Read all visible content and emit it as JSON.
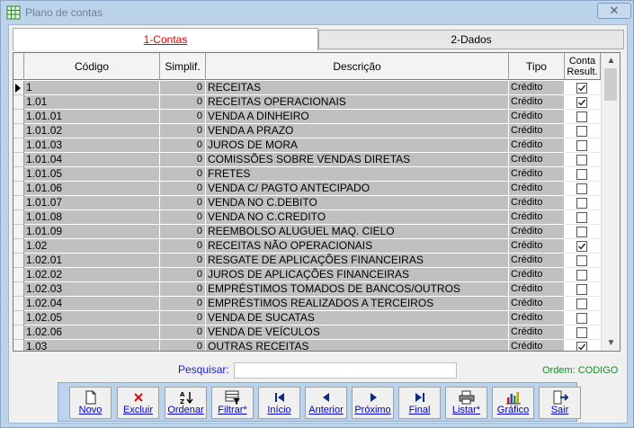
{
  "window": {
    "title": "Plano de contas",
    "close_glyph": "✕"
  },
  "tabs": [
    {
      "label": "1-Contas"
    },
    {
      "label": "2-Dados"
    }
  ],
  "grid": {
    "headers": {
      "codigo": "Código",
      "simplif": "Simplif.",
      "descricao": "Descrição",
      "tipo": "Tipo",
      "conta_result_line1": "Conta",
      "conta_result_line2": "Result."
    },
    "rows": [
      {
        "codigo": "1",
        "simplif": "0",
        "descricao": "RECEITAS",
        "tipo": "Crédito",
        "result": true
      },
      {
        "codigo": "1.01",
        "simplif": "0",
        "descricao": "RECEITAS OPERACIONAIS",
        "tipo": "Crédito",
        "result": true
      },
      {
        "codigo": "1.01.01",
        "simplif": "0",
        "descricao": "VENDA A DINHEIRO",
        "tipo": "Crédito",
        "result": false
      },
      {
        "codigo": "1.01.02",
        "simplif": "0",
        "descricao": "VENDA A PRAZO",
        "tipo": "Crédito",
        "result": false
      },
      {
        "codigo": "1.01.03",
        "simplif": "0",
        "descricao": "JUROS DE MORA",
        "tipo": "Crédito",
        "result": false
      },
      {
        "codigo": "1.01.04",
        "simplif": "0",
        "descricao": "COMISSÕES SOBRE VENDAS DIRETAS",
        "tipo": "Crédito",
        "result": false
      },
      {
        "codigo": "1.01.05",
        "simplif": "0",
        "descricao": "FRETES",
        "tipo": "Crédito",
        "result": false
      },
      {
        "codigo": "1.01.06",
        "simplif": "0",
        "descricao": "VENDA C/ PAGTO ANTECIPADO",
        "tipo": "Crédito",
        "result": false
      },
      {
        "codigo": "1.01.07",
        "simplif": "0",
        "descricao": "VENDA NO C.DEBITO",
        "tipo": "Crédito",
        "result": false
      },
      {
        "codigo": "1.01.08",
        "simplif": "0",
        "descricao": "VENDA NO C.CREDITO",
        "tipo": "Crédito",
        "result": false
      },
      {
        "codigo": "1.01.09",
        "simplif": "0",
        "descricao": "REEMBOLSO ALUGUEL MAQ. CIELO",
        "tipo": "Crédito",
        "result": false
      },
      {
        "codigo": "1.02",
        "simplif": "0",
        "descricao": "RECEITAS NÃO OPERACIONAIS",
        "tipo": "Crédito",
        "result": true
      },
      {
        "codigo": "1.02.01",
        "simplif": "0",
        "descricao": "RESGATE DE APLICAÇÕES FINANCEIRAS",
        "tipo": "Crédito",
        "result": false
      },
      {
        "codigo": "1.02.02",
        "simplif": "0",
        "descricao": "JUROS DE APLICAÇÕES FINANCEIRAS",
        "tipo": "Crédito",
        "result": false
      },
      {
        "codigo": "1.02.03",
        "simplif": "0",
        "descricao": "EMPRÉSTIMOS TOMADOS DE BANCOS/OUTROS",
        "tipo": "Crédito",
        "result": false
      },
      {
        "codigo": "1.02.04",
        "simplif": "0",
        "descricao": "EMPRÉSTIMOS REALIZADOS A TERCEIROS",
        "tipo": "Crédito",
        "result": false
      },
      {
        "codigo": "1.02.05",
        "simplif": "0",
        "descricao": "VENDA DE SUCATAS",
        "tipo": "Crédito",
        "result": false
      },
      {
        "codigo": "1.02.06",
        "simplif": "0",
        "descricao": "VENDA DE VEÍCULOS",
        "tipo": "Crédito",
        "result": false
      },
      {
        "codigo": "1.03",
        "simplif": "0",
        "descricao": "OUTRAS RECEITAS",
        "tipo": "Crédito",
        "result": true
      }
    ],
    "selected_row_index": 0
  },
  "search": {
    "label": "Pesquisar:",
    "value": ""
  },
  "order_status": "Ordem: CODIGO",
  "toolbar": [
    {
      "label": "Novo",
      "icon": "new-document-icon"
    },
    {
      "label": "Excluir",
      "icon": "delete-icon"
    },
    {
      "label": "Ordenar",
      "icon": "sort-az-icon"
    },
    {
      "label": "Filtrar*",
      "icon": "filter-icon"
    },
    {
      "label": "Início",
      "icon": "first-record-icon"
    },
    {
      "label": "Anterior",
      "icon": "previous-record-icon"
    },
    {
      "label": "Próximo",
      "icon": "next-record-icon"
    },
    {
      "label": "Final",
      "icon": "last-record-icon"
    },
    {
      "label": "Listar*",
      "icon": "printer-icon"
    },
    {
      "label": "Gráfico",
      "icon": "chart-icon"
    },
    {
      "label": "Sair",
      "icon": "exit-door-icon"
    }
  ],
  "colors": {
    "window_bg": "#bcd3ec",
    "cell_bg": "#c0c0c0",
    "active_tab_text": "#e00000",
    "link_blue": "#0000c8",
    "order_green": "#1a8a2a"
  }
}
